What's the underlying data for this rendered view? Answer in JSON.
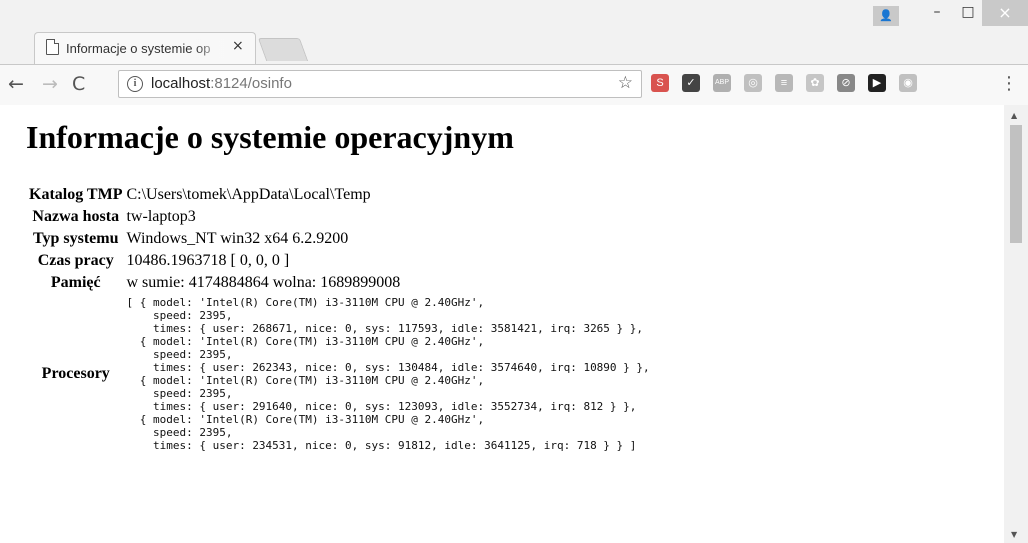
{
  "browser": {
    "tab_title": "Informacje o systemie op",
    "tab_close": "×",
    "url_host": "localhost",
    "url_path": ":8124/osinfo",
    "back": "←",
    "forward": "→",
    "reload": "C",
    "star": "☆",
    "menu": "⋮",
    "window_min": "–",
    "window_max": "□",
    "window_close": "×",
    "extensions": [
      {
        "name": "s-extension-icon",
        "label": "S",
        "color": "#d9534f"
      },
      {
        "name": "checkmark-extension-icon",
        "label": "✓",
        "color": "#444444"
      },
      {
        "name": "adblock-icon",
        "label": "ABP",
        "color": "#b0b0b0"
      },
      {
        "name": "circle-extension-icon",
        "label": "◎",
        "color": "#c0c0c0"
      },
      {
        "name": "database-extension-icon",
        "label": "≡",
        "color": "#b8b8b8"
      },
      {
        "name": "badge-extension-icon",
        "label": "✿",
        "color": "#c6c6c6"
      },
      {
        "name": "link-extension-icon",
        "label": "⊘",
        "color": "#888888"
      },
      {
        "name": "play-extension-icon",
        "label": "▶",
        "color": "#222222"
      },
      {
        "name": "sync-extension-icon",
        "label": "◉",
        "color": "#c0c0c0"
      }
    ]
  },
  "page": {
    "title": "Informacje o systemie operacyjnym",
    "rows": [
      {
        "label": "Katalog TMP",
        "value": "C:\\Users\\tomek\\AppData\\Local\\Temp"
      },
      {
        "label": "Nazwa hosta",
        "value": "tw-laptop3"
      },
      {
        "label": "Typ systemu",
        "value": "Windows_NT win32 x64 6.2.9200"
      },
      {
        "label": "Czas pracy",
        "value": "10486.1963718 [ 0, 0, 0 ]"
      },
      {
        "label": "Pamięć",
        "value": "w sumie: 4174884864 wolna: 1689899008"
      }
    ],
    "cpu_label": "Procesory",
    "cpu_text": "[ { model: 'Intel(R) Core(TM) i3-3110M CPU @ 2.40GHz',\n    speed: 2395,\n    times: { user: 268671, nice: 0, sys: 117593, idle: 3581421, irq: 3265 } },\n  { model: 'Intel(R) Core(TM) i3-3110M CPU @ 2.40GHz',\n    speed: 2395,\n    times: { user: 262343, nice: 0, sys: 130484, idle: 3574640, irq: 10890 } },\n  { model: 'Intel(R) Core(TM) i3-3110M CPU @ 2.40GHz',\n    speed: 2395,\n    times: { user: 291640, nice: 0, sys: 123093, idle: 3552734, irq: 812 } },\n  { model: 'Intel(R) Core(TM) i3-3110M CPU @ 2.40GHz',\n    speed: 2395,\n    times: { user: 234531, nice: 0, sys: 91812, idle: 3641125, irq: 718 } } ]"
  }
}
